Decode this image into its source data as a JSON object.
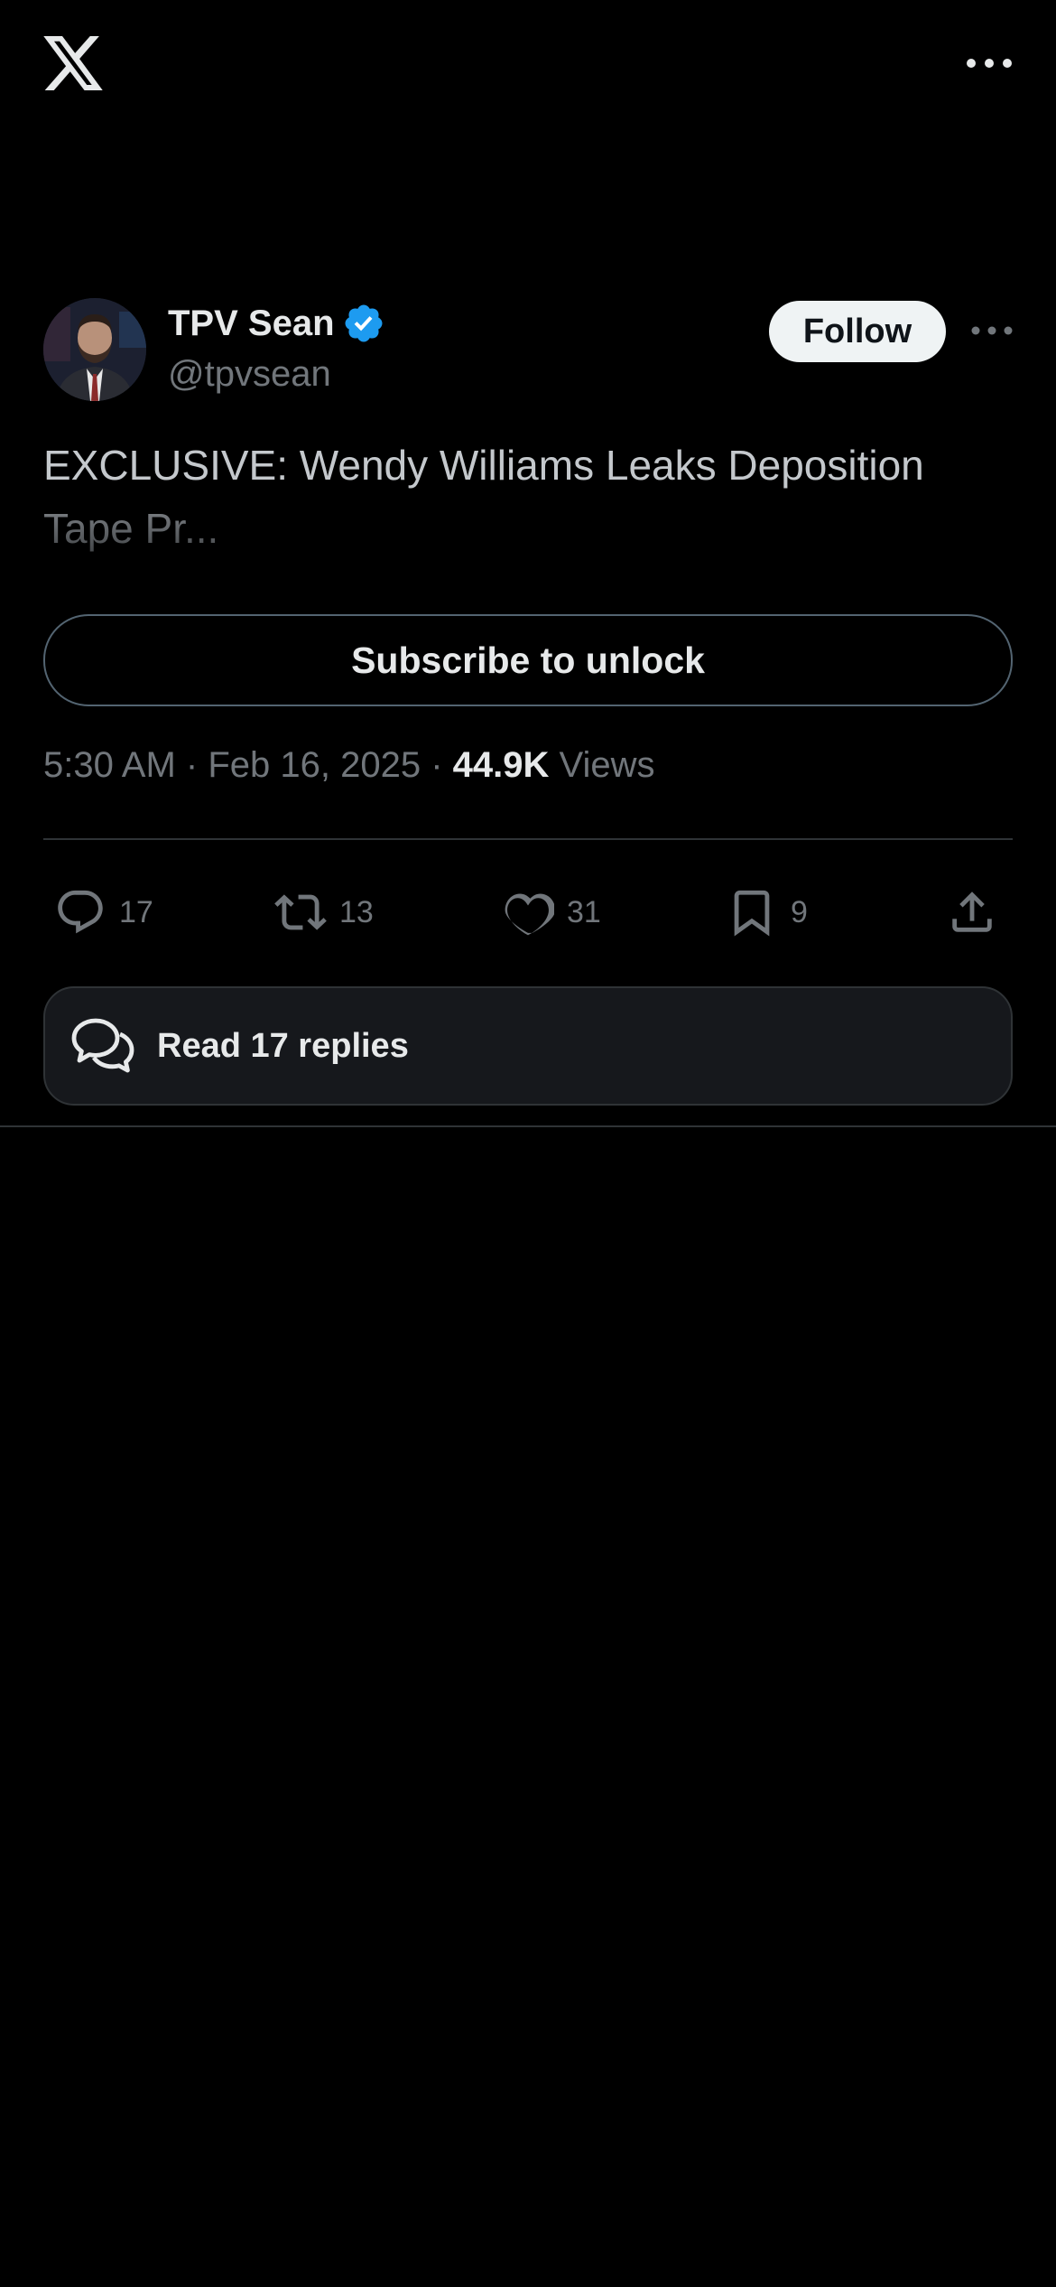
{
  "header": {
    "logo_icon": "x-logo-icon",
    "more_icon": "more-horizontal-icon"
  },
  "tweet": {
    "author_name": "TPV Sean",
    "author_handle": "@tpvsean",
    "verified_color": "#1d9bf0",
    "follow_label": "Follow",
    "text_line1": "EXCLUSIVE: Wendy Williams Leaks Deposition",
    "text_line2": "Tape Pr...",
    "subscribe_label": "Subscribe to unlock",
    "time": "5:30 AM",
    "sep1": "·",
    "date": "Feb 16, 2025",
    "sep2": "·",
    "views_count": "44.9K",
    "views_label": "Views"
  },
  "actions": {
    "replies": "17",
    "reposts": "13",
    "likes": "31",
    "bookmarks": "9"
  },
  "replies_button": {
    "label": "Read 17 replies"
  },
  "colors": {
    "background": "#000000",
    "accent": "#1d9bf0",
    "muted": "#71767b"
  }
}
